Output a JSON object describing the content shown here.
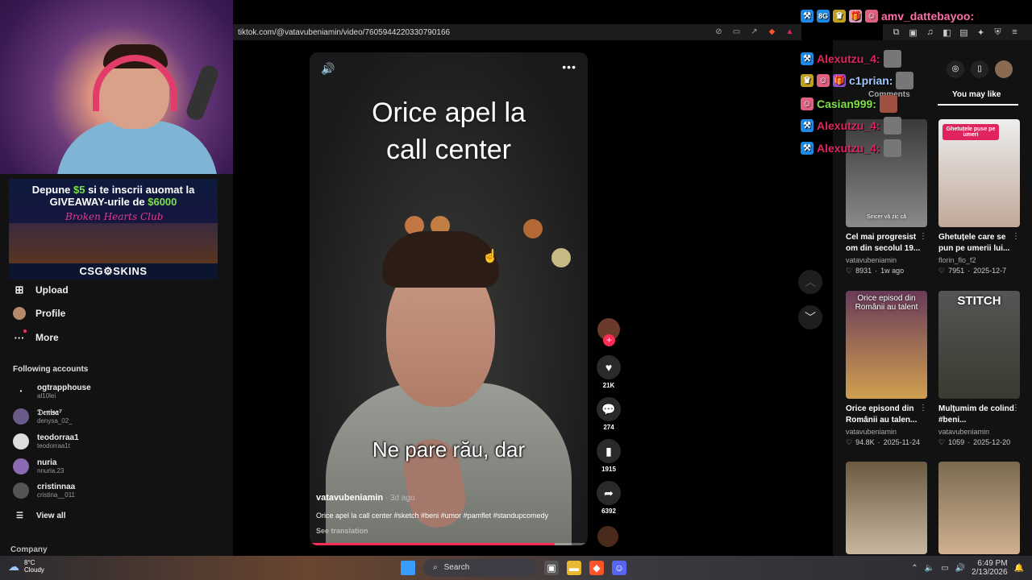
{
  "browser": {
    "url": "tiktok.com/@vatavubeniamin/video/7605944220330790166"
  },
  "ad": {
    "line1_pre": "Depune ",
    "line1_amount": "$5",
    "line1_post": " si te inscrii auomat la",
    "line2_pre": "GIVEAWAY-urile de ",
    "line2_amount": "$6000",
    "club": "Broken Hearts Club",
    "brand": "CSG⚙SKINS"
  },
  "sidebar": {
    "nav": [
      {
        "label": "Upload",
        "icon": "upload-icon"
      },
      {
        "label": "Profile",
        "icon": "profile-avatar"
      },
      {
        "label": "More",
        "icon": "more-icon"
      }
    ],
    "following_title": "Following accounts",
    "following": [
      {
        "display": "ogtrapphouse",
        "user": "al10lei"
      },
      {
        "display": "𝔇𝔢𝔫𝔦𝔰𝔞⁷",
        "user": "denysa_02_"
      },
      {
        "display": "teodorraa1",
        "user": "teodorraa1t"
      },
      {
        "display": "nuria",
        "user": "nnuria.23"
      },
      {
        "display": "cristinnaa",
        "user": "cristina__011"
      }
    ],
    "view_all": "View all",
    "company": "Company"
  },
  "video": {
    "caption_top_1": "Orice apel la",
    "caption_top_2": "call center",
    "caption_bottom": "Ne pare rău, dar",
    "author": "vatavubeniamin",
    "ago": " · 3d ago",
    "description": "Orice apel la call center #sketch #beni #umor #pamflet #standupcomedy",
    "see_translation": "See translation",
    "progress": 0.88
  },
  "actions": {
    "likes": "21K",
    "comments": "274",
    "saves": "1915",
    "shares": "6392"
  },
  "right_panel": {
    "tab_comments": "Comments",
    "tab_you_may_like": "You may like",
    "cards": [
      {
        "overlay": "Sincer vă zic că",
        "tag": "",
        "title": "Cel mai progresist om din secolul 19...",
        "author": "vatavubeniamin",
        "likes": "8931",
        "date": "1w ago",
        "bg": "#5a5a5a"
      },
      {
        "overlay": "",
        "tag": "Ghetuțele puse pe umeri",
        "title": "Ghetuțele care se pun pe umerii lui...",
        "author": "florin_flo_f2",
        "likes": "7951",
        "date": "2025-12-7",
        "bg": "#d9d4d0"
      },
      {
        "overlay": "Orice episod din Românii au talent",
        "tag": "",
        "title": "Orice episond din Românii au talen...",
        "author": "vatavubeniamin",
        "likes": "94.8K",
        "date": "2025-11-24",
        "bg": "#6a4a3a"
      },
      {
        "overlay": "STITCH",
        "tag": "",
        "title": "Mulțumim de colind #beni...",
        "author": "vatavubeniamin",
        "likes": "1059",
        "date": "2025-12-20",
        "bg": "#4a4a44"
      }
    ]
  },
  "chat": [
    {
      "name": "amv_dattebayoo:",
      "color": "#ff6fa8"
    },
    {
      "name": "Alexutzu_4:",
      "color": "#e0245e"
    },
    {
      "name": "c1prian:",
      "color": "#a0c8ff"
    },
    {
      "name": "Casian999:",
      "color": "#7ee04a"
    },
    {
      "name": "Alexutzu_4:",
      "color": "#e0245e"
    },
    {
      "name": "Alexutzu_4:",
      "color": "#e0245e"
    }
  ],
  "taskbar": {
    "temp": "8°C",
    "condition": "Cloudy",
    "search": "Search",
    "time": "6:49 PM",
    "date": "2/13/2026"
  }
}
